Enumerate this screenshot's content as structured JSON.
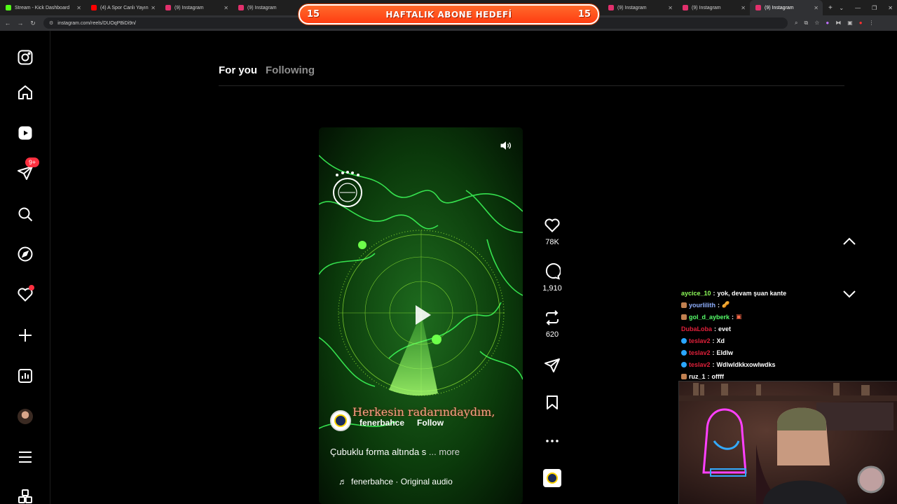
{
  "browser": {
    "tabs": [
      {
        "label": "Stream - Kick Dashboard",
        "favicon_color": "#53fc18"
      },
      {
        "label": "(4) A Spor Canlı Yayın",
        "favicon_color": "#ff0000"
      },
      {
        "label": "(9) Instagram",
        "favicon_color": "#e1306c"
      },
      {
        "label": "(9) Instagram",
        "favicon_color": "#e1306c"
      },
      {
        "label": "(9) Instagram",
        "favicon_color": "#e1306c"
      },
      {
        "label": "(9) Instagram",
        "favicon_color": "#e1306c"
      },
      {
        "label": "(9) Instagram",
        "favicon_color": "#e1306c"
      }
    ],
    "url": "instagram.com/reels/DUOqPBiDi9n/"
  },
  "overlay": {
    "goal_left": "15",
    "goal_title": "HAFTALIK ABONE HEDEFİ",
    "goal_right": "15",
    "accent": "#ff4a18"
  },
  "sidebar": {
    "notifications_badge": "9+",
    "items": [
      "instagram-logo",
      "home-icon",
      "reels-icon",
      "messages-icon",
      "search-icon",
      "explore-icon",
      "notifications-icon",
      "create-icon",
      "dashboard-icon",
      "profile-avatar",
      "menu-icon",
      "also-from-meta-icon"
    ]
  },
  "feed": {
    "tab_for_you": "For you",
    "tab_following": "Following"
  },
  "reel": {
    "overlay_text": "Herkesin radarındaydım,",
    "author": "fenerbahce",
    "follow_label": "Follow",
    "description": "Çubuklu forma altında s",
    "more_label": "... more",
    "audio": "fenerbahce · Original audio"
  },
  "actions": {
    "likes": "78K",
    "comments": "1,910",
    "reposts": "620"
  },
  "chat": [
    {
      "user": "aycice_10",
      "user_color": "#8fff5a",
      "message": "yok, devam şuan kante",
      "badge_color": null
    },
    {
      "user": "yourlilith",
      "user_color": "#8fb0ff",
      "message": "",
      "badge_color": "#c08050"
    },
    {
      "user": "gol_d_ayberk",
      "user_color": "#56ff6a",
      "message": "",
      "badge_color": "#c08050"
    },
    {
      "user": "DubaLoba",
      "user_color": "#e0203a",
      "message": "evet",
      "badge_color": null
    },
    {
      "user": "teslav2",
      "user_color": "#e0203a",
      "message": "Xd",
      "badge_color": "#2aa6ff"
    },
    {
      "user": "teslav2",
      "user_color": "#e0203a",
      "message": "Eldlw",
      "badge_color": "#2aa6ff"
    },
    {
      "user": "teslav2",
      "user_color": "#e0203a",
      "message": "Wdlwldkkxowlwdks",
      "badge_color": "#2aa6ff"
    },
    {
      "user": "ruz_1",
      "user_color": "#ffffff",
      "message": "offff",
      "badge_color": "#c08050"
    }
  ]
}
